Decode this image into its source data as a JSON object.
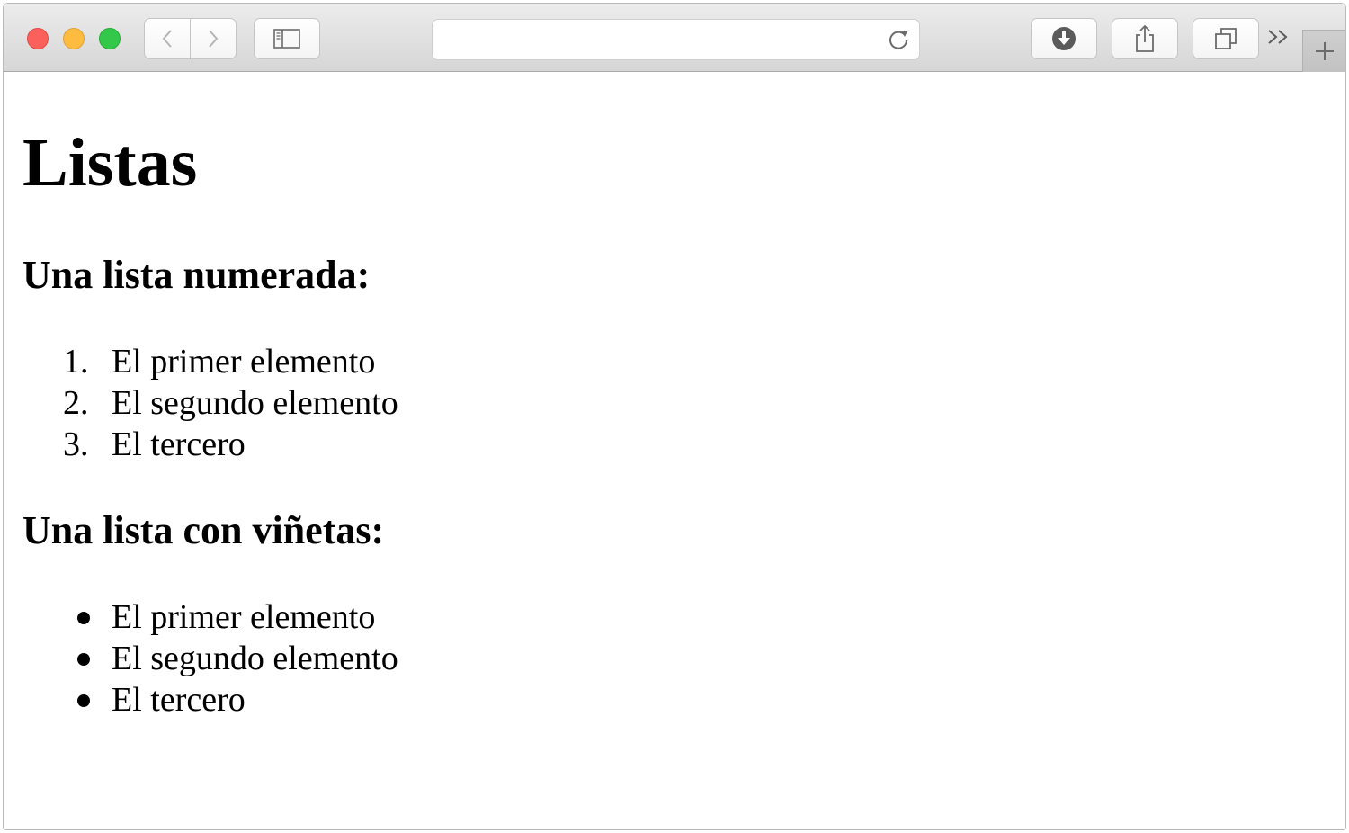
{
  "browser": {
    "address_value": "",
    "icons": {
      "back": "chevron-left-icon",
      "forward": "chevron-right-icon",
      "sidebar": "sidebar-icon",
      "reload": "reload-icon",
      "downloads": "download-icon",
      "share": "share-icon",
      "tabs": "tabs-overview-icon",
      "more": "double-chevron-right-icon",
      "new_tab": "plus-icon"
    },
    "colors": {
      "close": "#fc605c",
      "minimize": "#fdbc40",
      "zoom": "#34c84a"
    }
  },
  "page": {
    "title": "Listas",
    "ordered_heading": "Una lista numerada:",
    "ordered_items": [
      {
        "marker": "1.",
        "text": "El primer elemento"
      },
      {
        "marker": "2.",
        "text": "El segundo elemento"
      },
      {
        "marker": "3.",
        "text": "El tercero"
      }
    ],
    "unordered_heading": "Una lista con viñetas:",
    "unordered_items": [
      {
        "text": "El primer elemento"
      },
      {
        "text": "El segundo elemento"
      },
      {
        "text": "El tercero"
      }
    ]
  }
}
